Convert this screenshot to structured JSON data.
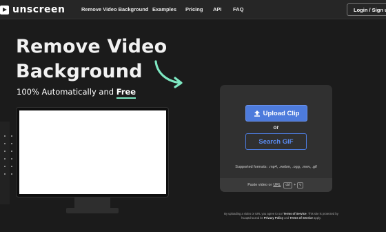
{
  "nav": {
    "logo_text": "unscreen",
    "links": [
      "Remove Video Background",
      "Examples",
      "Pricing",
      "API",
      "FAQ"
    ],
    "login_label": "Login / Sign up"
  },
  "hero": {
    "headline_line1": "Remove Video",
    "headline_line2": "Background",
    "subtitle_prefix": "100% Automatically and ",
    "subtitle_emphasis": "Free"
  },
  "upload": {
    "upload_button_label": "Upload Clip",
    "or_label": "or",
    "search_gif_label": "Search GIF",
    "supported_formats": "Supported formats: .mp4, .webm, .ogg, .mov, .gif",
    "paste_prefix": "Paste video or",
    "paste_url": "URL",
    "key_ctrl": "ctrl",
    "key_plus": "+",
    "key_v": "v"
  },
  "legal": {
    "part1": "By uploading a video or URL you agree to our ",
    "terms1": "Terms of Service",
    "part2": ". This site is protected by hCaptcha and its ",
    "privacy": "Privacy Policy",
    "part3": " and ",
    "terms2": "Terms of Service",
    "part4": " apply."
  },
  "colors": {
    "accent_blue": "#4d7bdc",
    "accent_mint": "#7ee8c2",
    "background": "#1b1b1b"
  }
}
